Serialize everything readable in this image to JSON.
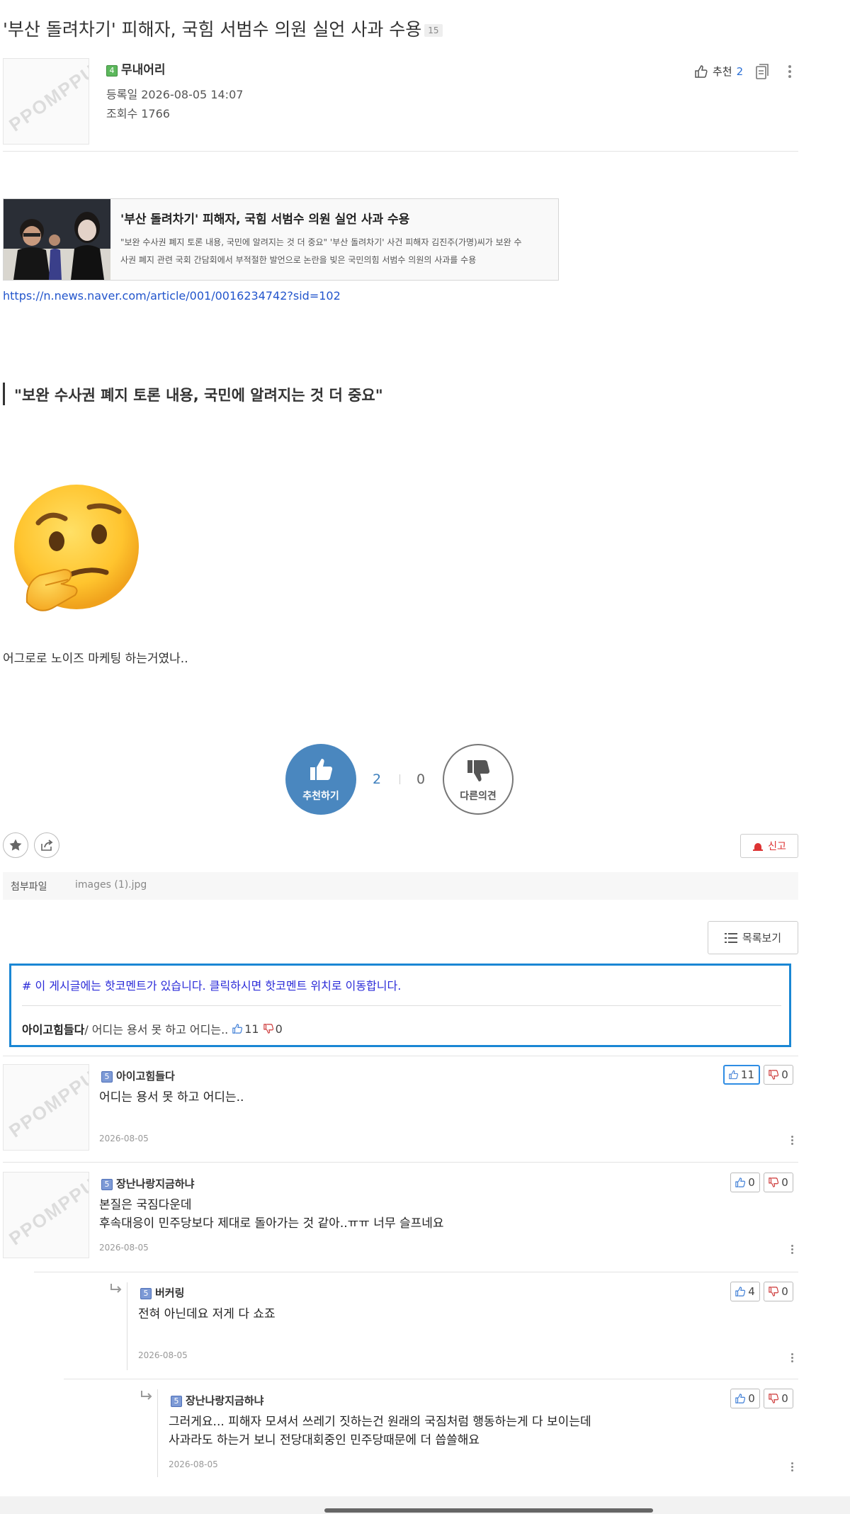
{
  "post": {
    "title": "'부산 돌려차기' 피해자, 국힘 서범수 의원 실언 사과 수용",
    "comment_count": "15",
    "avatar_watermark": "PPOMPPU",
    "author": {
      "level": "4",
      "name": "무내어리"
    },
    "registered": "등록일 2026-08-05 14:07",
    "views": "조회수 1766",
    "recommend_label": "추천",
    "recommend_count": "2"
  },
  "link_card": {
    "title": "'부산 돌려차기' 피해자, 국힘 서범수 의원 실언 사과 수용",
    "desc_line1": "\"보완 수사권 폐지 토론 내용, 국민에 알려지는 것 더 중요\" '부산 돌려차기' 사건 피해자 김진주(가명)씨가 보완 수",
    "desc_line2": "사권 폐지 관련 국회 간담회에서 부적절한 발언으로 논란을 빚은 국민의힘 서범수 의원의 사과를 수용",
    "url": "https://n.news.naver.com/article/001/0016234742?sid=102"
  },
  "body": {
    "quote": "\"보완 수사권 폐지 토론 내용, 국민에 알려지는 것 더 중요\"",
    "text": "어그로로 노이즈 마케팅 하는거였나.."
  },
  "vote_box": {
    "up_label": "추천하기",
    "up_count": "2",
    "down_count": "0",
    "down_label": "다른의견"
  },
  "actions": {
    "report_label": "신고"
  },
  "attachment": {
    "label": "첨부파일",
    "file": "images (1).jpg"
  },
  "list_button": "목록보기",
  "hot_comment": {
    "notice": "# 이 게시글에는 핫코멘트가 있습니다. 클릭하시면 핫코멘트 위치로 이동합니다.",
    "author": "아이고힘들다",
    "text": " / 어디는 용서 못 하고 어디는..",
    "up": "11",
    "down": "0"
  },
  "comments": [
    {
      "level": "5",
      "name": "아이고힘들다",
      "line1": "어디는 용서 못 하고 어디는..",
      "line2": "",
      "date": "2026-08-05",
      "up": "11",
      "down": "0"
    },
    {
      "level": "5",
      "name": "장난나랑지금하냐",
      "line1": "본질은 국짐다운데",
      "line2": "후속대응이 민주당보다 제대로 돌아가는 것 같아..ㅠㅠ 너무 슬프네요",
      "date": "2026-08-05",
      "up": "0",
      "down": "0"
    },
    {
      "level": "5",
      "name": "버커링",
      "line1": "전혀 아닌데요 저게 다 쇼죠",
      "line2": "",
      "date": "2026-08-05",
      "up": "4",
      "down": "0"
    },
    {
      "level": "5",
      "name": "장난나랑지금하냐",
      "line1": "그러게요... 피해자 모셔서 쓰레기 짓하는건 원래의 국짐처럼 행동하는게 다 보이는데",
      "line2": "사과라도 하는거 보니 전당대회중인 민주당때문에 더 씁쓸해요",
      "date": "2026-08-05",
      "up": "0",
      "down": "0"
    }
  ],
  "colors": {
    "accent_blue": "#4a87bf",
    "link": "#2255cc",
    "hot_border": "#1a87d4",
    "report_red": "#d33"
  }
}
